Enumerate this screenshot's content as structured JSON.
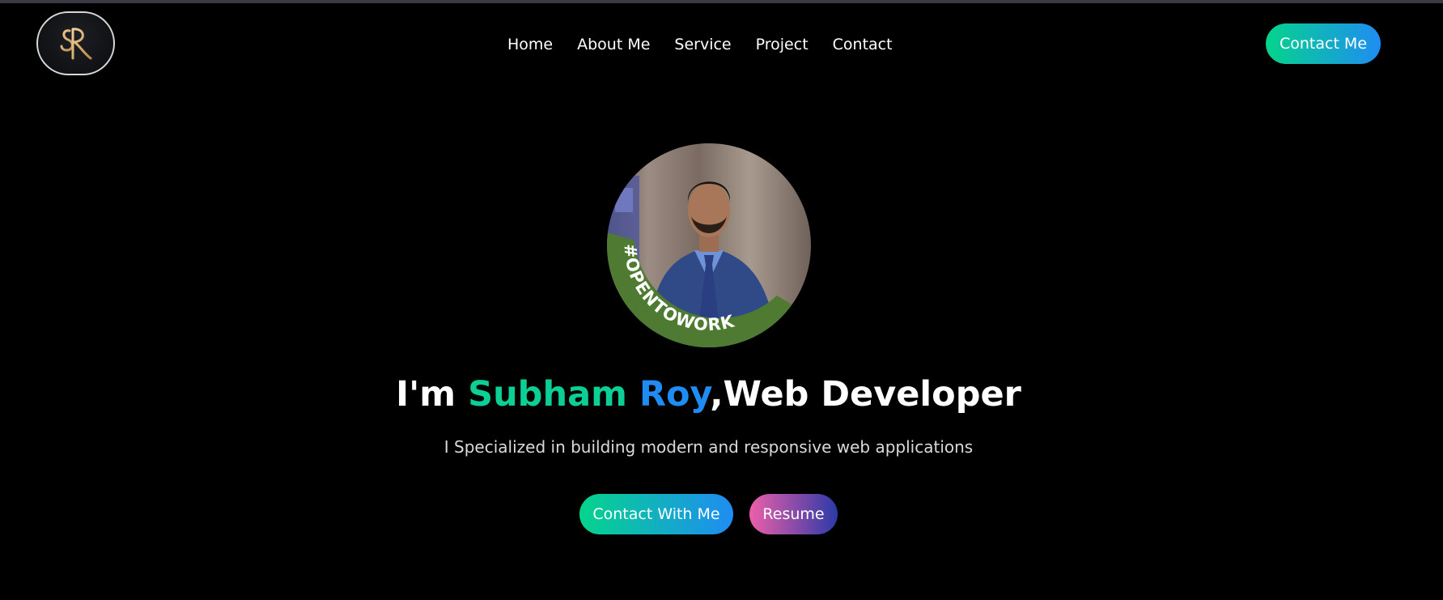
{
  "header": {
    "logo_text": "SR",
    "nav": [
      "Home",
      "About Me",
      "Service",
      "Project",
      "Contact"
    ],
    "contact_button": "Contact Me"
  },
  "hero": {
    "avatar_badge": "#OPENTOWORK",
    "headline": {
      "prefix": "I'm ",
      "first_name": "Subham",
      "space": " ",
      "last_name": "Roy",
      "suffix": ",Web Developer"
    },
    "subtitle": "I Specialized in building modern and responsive web applications",
    "buttons": {
      "contact": "Contact With Me",
      "resume": "Resume"
    }
  },
  "colors": {
    "background": "#000000",
    "accent_green": "#05d48c",
    "accent_blue": "#1f8cf3",
    "accent_pink": "#ec5fa9",
    "accent_indigo": "#2b3aa8",
    "badge_green": "#4e7a32"
  }
}
